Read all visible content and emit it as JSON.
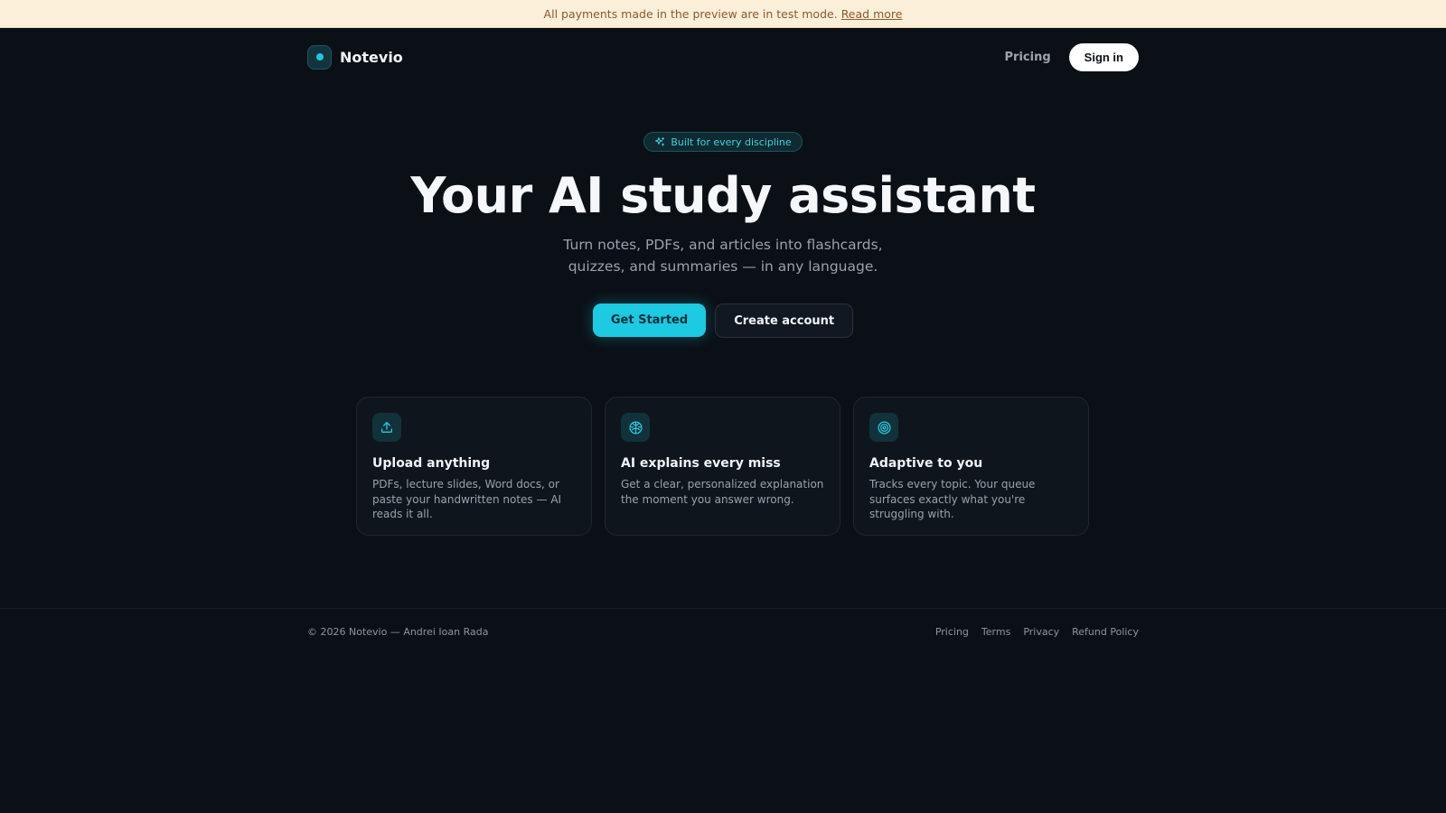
{
  "banner": {
    "text": "All payments made in the preview are in test mode.",
    "link": "Read more"
  },
  "nav": {
    "brand": "Notevio",
    "pricing": "Pricing",
    "sign_in": "Sign in"
  },
  "hero": {
    "badge": "Built for every discipline",
    "title": "Your AI study assistant",
    "subtitle": "Turn notes, PDFs, and articles into flashcards, quizzes, and summaries — in any language.",
    "primary_cta": "Get Started",
    "secondary_cta": "Create account"
  },
  "features": [
    {
      "icon": "upload-icon",
      "title": "Upload anything",
      "description": "PDFs, lecture slides, Word docs, or paste your handwritten notes — AI reads it all."
    },
    {
      "icon": "brain-icon",
      "title": "AI explains every miss",
      "description": "Get a clear, personalized explanation the moment you answer wrong."
    },
    {
      "icon": "target-icon",
      "title": "Adaptive to you",
      "description": "Tracks every topic. Your queue surfaces exactly what you're struggling with."
    }
  ],
  "footer": {
    "copyright": "© 2026 Notevio — Andrei Ioan Rada",
    "links": [
      "Pricing",
      "Terms",
      "Privacy",
      "Refund Policy"
    ]
  },
  "colors": {
    "accent": "#1ec9e2",
    "background": "#0b1016",
    "banner_bg": "#fcefd9"
  }
}
